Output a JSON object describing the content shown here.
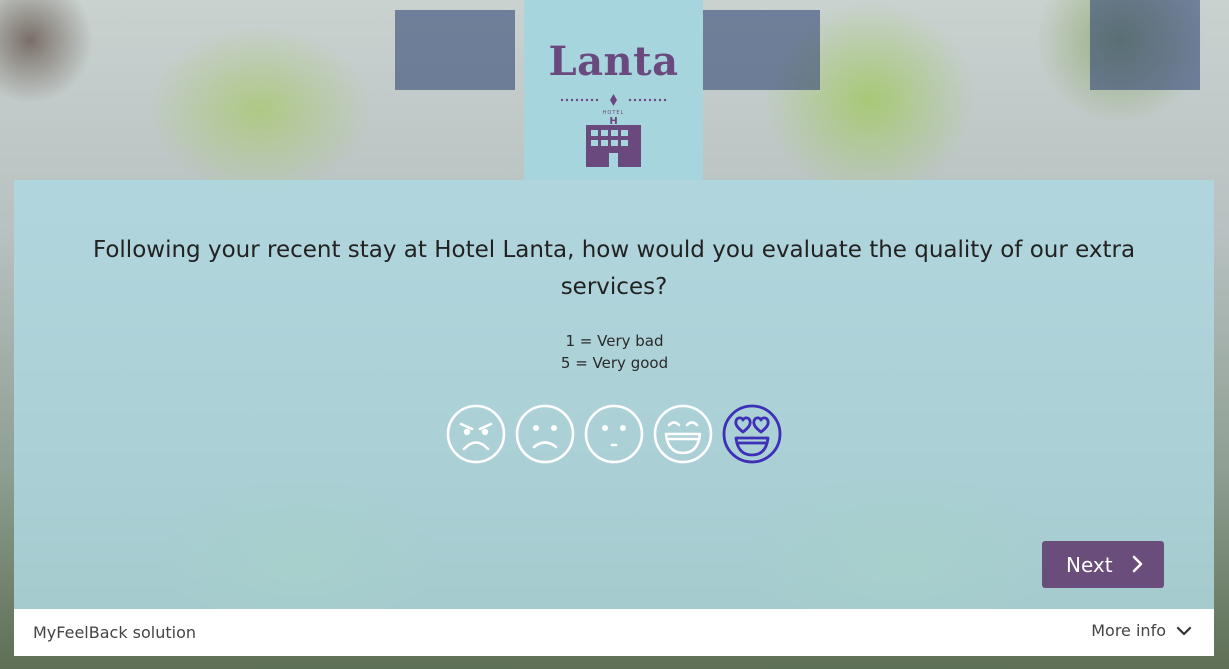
{
  "logo": {
    "name": "Lanta",
    "sub": "HOTEL",
    "building_letter": "H",
    "colors": {
      "background": "#a7d5de",
      "brand": "#6a4a7e"
    }
  },
  "survey": {
    "question": "Following your recent stay at Hotel Lanta, how would you evaluate the quality of our extra services?",
    "scale_low": "1 = Very bad",
    "scale_high": "5 = Very good",
    "rating_options": [
      {
        "value": 1,
        "icon": "angry-face-icon"
      },
      {
        "value": 2,
        "icon": "sad-face-icon"
      },
      {
        "value": 3,
        "icon": "neutral-face-icon"
      },
      {
        "value": 4,
        "icon": "happy-face-icon"
      },
      {
        "value": 5,
        "icon": "heart-eyes-face-icon"
      }
    ],
    "highlighted_option": 5,
    "colors": {
      "face_default": "#ffffff",
      "face_highlight": "#3d2fb8"
    }
  },
  "navigation": {
    "next_label": "Next",
    "next_icon": "chevron-right-icon",
    "color": "#6a4d7a"
  },
  "footer": {
    "brand": "MyFeelBack solution",
    "more_info": "More info",
    "more_info_icon": "chevron-down-icon"
  }
}
